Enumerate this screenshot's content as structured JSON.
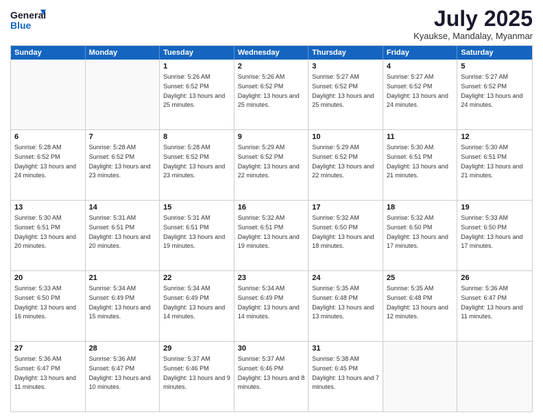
{
  "logo": {
    "line1": "General",
    "line2": "Blue"
  },
  "title": "July 2025",
  "location": "Kyaukse, Mandalay, Myanmar",
  "header_days": [
    "Sunday",
    "Monday",
    "Tuesday",
    "Wednesday",
    "Thursday",
    "Friday",
    "Saturday"
  ],
  "weeks": [
    [
      {
        "day": "",
        "sunrise": "",
        "sunset": "",
        "daylight": ""
      },
      {
        "day": "",
        "sunrise": "",
        "sunset": "",
        "daylight": ""
      },
      {
        "day": "1",
        "sunrise": "Sunrise: 5:26 AM",
        "sunset": "Sunset: 6:52 PM",
        "daylight": "Daylight: 13 hours and 25 minutes."
      },
      {
        "day": "2",
        "sunrise": "Sunrise: 5:26 AM",
        "sunset": "Sunset: 6:52 PM",
        "daylight": "Daylight: 13 hours and 25 minutes."
      },
      {
        "day": "3",
        "sunrise": "Sunrise: 5:27 AM",
        "sunset": "Sunset: 6:52 PM",
        "daylight": "Daylight: 13 hours and 25 minutes."
      },
      {
        "day": "4",
        "sunrise": "Sunrise: 5:27 AM",
        "sunset": "Sunset: 6:52 PM",
        "daylight": "Daylight: 13 hours and 24 minutes."
      },
      {
        "day": "5",
        "sunrise": "Sunrise: 5:27 AM",
        "sunset": "Sunset: 6:52 PM",
        "daylight": "Daylight: 13 hours and 24 minutes."
      }
    ],
    [
      {
        "day": "6",
        "sunrise": "Sunrise: 5:28 AM",
        "sunset": "Sunset: 6:52 PM",
        "daylight": "Daylight: 13 hours and 24 minutes."
      },
      {
        "day": "7",
        "sunrise": "Sunrise: 5:28 AM",
        "sunset": "Sunset: 6:52 PM",
        "daylight": "Daylight: 13 hours and 23 minutes."
      },
      {
        "day": "8",
        "sunrise": "Sunrise: 5:28 AM",
        "sunset": "Sunset: 6:52 PM",
        "daylight": "Daylight: 13 hours and 23 minutes."
      },
      {
        "day": "9",
        "sunrise": "Sunrise: 5:29 AM",
        "sunset": "Sunset: 6:52 PM",
        "daylight": "Daylight: 13 hours and 22 minutes."
      },
      {
        "day": "10",
        "sunrise": "Sunrise: 5:29 AM",
        "sunset": "Sunset: 6:52 PM",
        "daylight": "Daylight: 13 hours and 22 minutes."
      },
      {
        "day": "11",
        "sunrise": "Sunrise: 5:30 AM",
        "sunset": "Sunset: 6:51 PM",
        "daylight": "Daylight: 13 hours and 21 minutes."
      },
      {
        "day": "12",
        "sunrise": "Sunrise: 5:30 AM",
        "sunset": "Sunset: 6:51 PM",
        "daylight": "Daylight: 13 hours and 21 minutes."
      }
    ],
    [
      {
        "day": "13",
        "sunrise": "Sunrise: 5:30 AM",
        "sunset": "Sunset: 6:51 PM",
        "daylight": "Daylight: 13 hours and 20 minutes."
      },
      {
        "day": "14",
        "sunrise": "Sunrise: 5:31 AM",
        "sunset": "Sunset: 6:51 PM",
        "daylight": "Daylight: 13 hours and 20 minutes."
      },
      {
        "day": "15",
        "sunrise": "Sunrise: 5:31 AM",
        "sunset": "Sunset: 6:51 PM",
        "daylight": "Daylight: 13 hours and 19 minutes."
      },
      {
        "day": "16",
        "sunrise": "Sunrise: 5:32 AM",
        "sunset": "Sunset: 6:51 PM",
        "daylight": "Daylight: 13 hours and 19 minutes."
      },
      {
        "day": "17",
        "sunrise": "Sunrise: 5:32 AM",
        "sunset": "Sunset: 6:50 PM",
        "daylight": "Daylight: 13 hours and 18 minutes."
      },
      {
        "day": "18",
        "sunrise": "Sunrise: 5:32 AM",
        "sunset": "Sunset: 6:50 PM",
        "daylight": "Daylight: 13 hours and 17 minutes."
      },
      {
        "day": "19",
        "sunrise": "Sunrise: 5:33 AM",
        "sunset": "Sunset: 6:50 PM",
        "daylight": "Daylight: 13 hours and 17 minutes."
      }
    ],
    [
      {
        "day": "20",
        "sunrise": "Sunrise: 5:33 AM",
        "sunset": "Sunset: 6:50 PM",
        "daylight": "Daylight: 13 hours and 16 minutes."
      },
      {
        "day": "21",
        "sunrise": "Sunrise: 5:34 AM",
        "sunset": "Sunset: 6:49 PM",
        "daylight": "Daylight: 13 hours and 15 minutes."
      },
      {
        "day": "22",
        "sunrise": "Sunrise: 5:34 AM",
        "sunset": "Sunset: 6:49 PM",
        "daylight": "Daylight: 13 hours and 14 minutes."
      },
      {
        "day": "23",
        "sunrise": "Sunrise: 5:34 AM",
        "sunset": "Sunset: 6:49 PM",
        "daylight": "Daylight: 13 hours and 14 minutes."
      },
      {
        "day": "24",
        "sunrise": "Sunrise: 5:35 AM",
        "sunset": "Sunset: 6:48 PM",
        "daylight": "Daylight: 13 hours and 13 minutes."
      },
      {
        "day": "25",
        "sunrise": "Sunrise: 5:35 AM",
        "sunset": "Sunset: 6:48 PM",
        "daylight": "Daylight: 13 hours and 12 minutes."
      },
      {
        "day": "26",
        "sunrise": "Sunrise: 5:36 AM",
        "sunset": "Sunset: 6:47 PM",
        "daylight": "Daylight: 13 hours and 11 minutes."
      }
    ],
    [
      {
        "day": "27",
        "sunrise": "Sunrise: 5:36 AM",
        "sunset": "Sunset: 6:47 PM",
        "daylight": "Daylight: 13 hours and 11 minutes."
      },
      {
        "day": "28",
        "sunrise": "Sunrise: 5:36 AM",
        "sunset": "Sunset: 6:47 PM",
        "daylight": "Daylight: 13 hours and 10 minutes."
      },
      {
        "day": "29",
        "sunrise": "Sunrise: 5:37 AM",
        "sunset": "Sunset: 6:46 PM",
        "daylight": "Daylight: 13 hours and 9 minutes."
      },
      {
        "day": "30",
        "sunrise": "Sunrise: 5:37 AM",
        "sunset": "Sunset: 6:46 PM",
        "daylight": "Daylight: 13 hours and 8 minutes."
      },
      {
        "day": "31",
        "sunrise": "Sunrise: 5:38 AM",
        "sunset": "Sunset: 6:45 PM",
        "daylight": "Daylight: 13 hours and 7 minutes."
      },
      {
        "day": "",
        "sunrise": "",
        "sunset": "",
        "daylight": ""
      },
      {
        "day": "",
        "sunrise": "",
        "sunset": "",
        "daylight": ""
      }
    ]
  ]
}
